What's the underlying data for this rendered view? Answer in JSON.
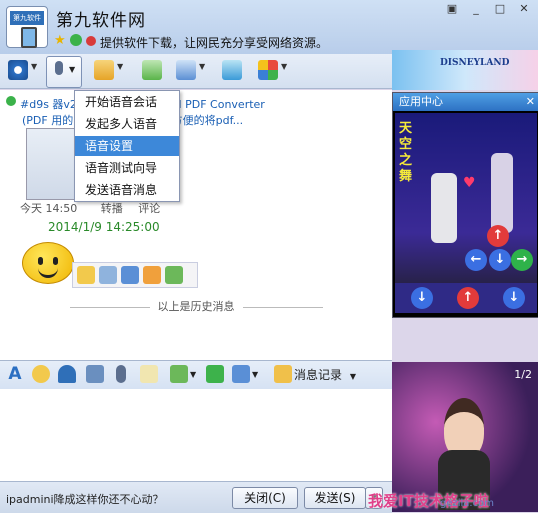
{
  "header": {
    "title": "第九软件网",
    "signature": "提供软件下载，让网民充分享受网络资源。",
    "avatar_text": "第九软件网"
  },
  "voice_menu": {
    "items": [
      "开始语音会话",
      "发起多人语音",
      "语音设置",
      "语音测试向导",
      "发送语音消息"
    ],
    "selected_index": 2
  },
  "chat": {
    "line1": "#d9s                   器v2.1.257中文版】Total PDF Converter",
    "line2": "(PDF                   用的PDF转换工具，可以方便的将pdf...",
    "meta_time": "今天 14:50",
    "meta_forward": "转播",
    "meta_comment": "评论",
    "timestamp": "2014/1/9 14:25:00",
    "history_label": "以上是历史消息"
  },
  "app_center": {
    "title": "应用中心",
    "game_title": "天空之舞"
  },
  "ad_banner": {
    "logo": "DISNEYLAND"
  },
  "input_toolbar": {
    "history_label": "消息记录"
  },
  "bottom": {
    "ad_text": "ipadmini降成这样你还不心动？",
    "close_label": "关闭(C)",
    "send_label": "发送(S)"
  },
  "side_show": {
    "page": "1/2"
  },
  "watermark": {
    "line1": "我爱IT技术格子啦",
    "line2": "gezila.com"
  },
  "colors": {
    "accent": "#3d88d9",
    "timestamp": "#2a8a2a",
    "link": "#1a5fb4"
  }
}
